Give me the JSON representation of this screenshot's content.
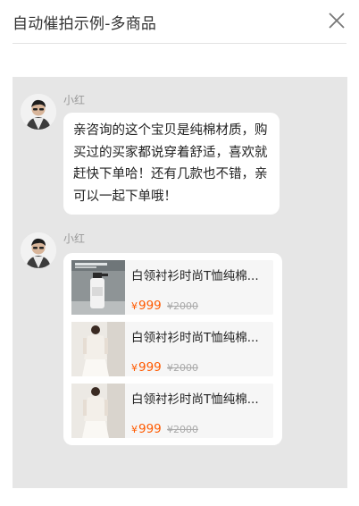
{
  "header": {
    "title": "自动催拍示例-多商品"
  },
  "messages": [
    {
      "sender": "小红",
      "text": "亲咨询的这个宝贝是纯棉材质，购买过的买家都说穿着舒适，喜欢就赶快下单哈！还有几款也不错，亲可以一起下单哦！"
    },
    {
      "sender": "小红",
      "products": [
        {
          "name": "白领衬衫时尚T恤纯棉...",
          "currency": "¥",
          "price": "999",
          "original_price": "¥2000"
        },
        {
          "name": "白领衬衫时尚T恤纯棉...",
          "currency": "¥",
          "price": "999",
          "original_price": "¥2000"
        },
        {
          "name": "白领衬衫时尚T恤纯棉...",
          "currency": "¥",
          "price": "999",
          "original_price": "¥2000"
        }
      ]
    }
  ],
  "colors": {
    "price": "#ff5a00",
    "chat_background": "#e6e6e6",
    "bubble": "#ffffff"
  },
  "icons": {
    "close": "close-icon"
  }
}
